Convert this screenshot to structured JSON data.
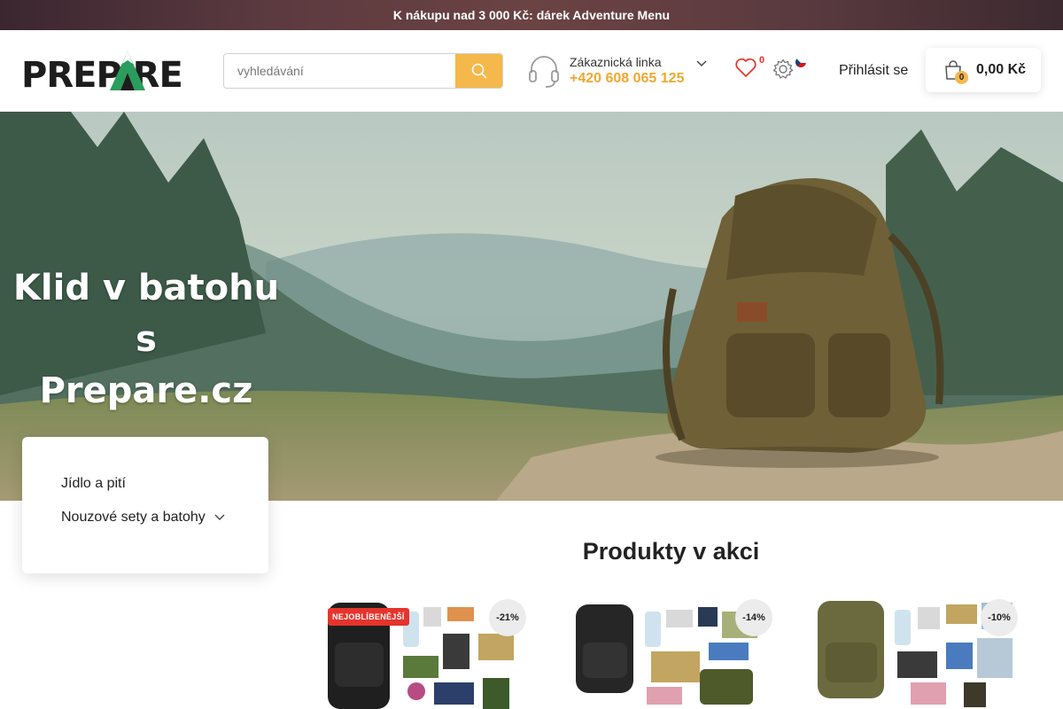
{
  "promo": {
    "text": "K nákupu nad 3 000 Kč: dárek Adventure Menu"
  },
  "header": {
    "logo_text": "PREP  RE",
    "search_placeholder": "vyhledávání",
    "hotline_label": "Zákaznická linka",
    "hotline_phone": "+420 608 065 125",
    "wishlist_count": "0",
    "login_label": "Přihlásit se",
    "cart_count": "0",
    "cart_total": "0,00 Kč",
    "accent_color": "#f5b84a"
  },
  "hero": {
    "title_line1": "Klid v batohu s",
    "title_line2": "Prepare.cz"
  },
  "category_menu": {
    "items": [
      {
        "label": "Jídlo a pití"
      },
      {
        "label": "Nouzové sety a batohy"
      }
    ]
  },
  "products_section": {
    "title": "Produkty v akci",
    "products": [
      {
        "badge": "NEJOBLÍBENĚJŠÍ",
        "discount": "-21%",
        "bag_color": "#1f1f1f"
      },
      {
        "badge": "",
        "discount": "-14%",
        "bag_color": "#262626"
      },
      {
        "badge": "",
        "discount": "-10%",
        "bag_color": "#6b6a3e"
      }
    ]
  }
}
